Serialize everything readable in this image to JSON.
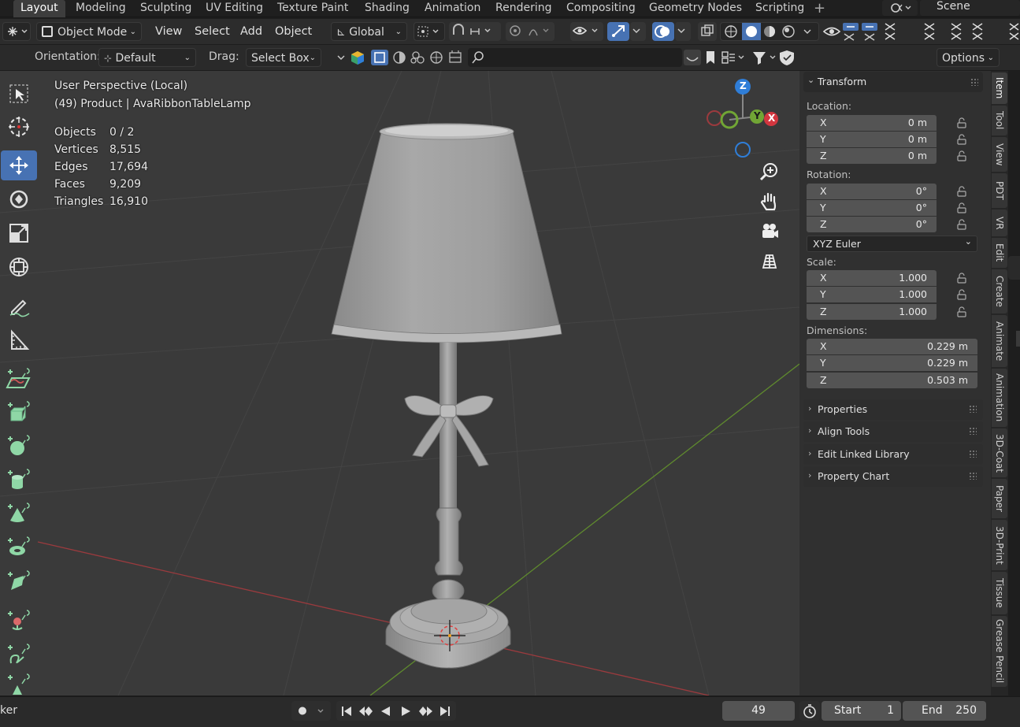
{
  "workspace_tabs": [
    "Layout",
    "Modeling",
    "Sculpting",
    "UV Editing",
    "Texture Paint",
    "Shading",
    "Animation",
    "Rendering",
    "Compositing",
    "Geometry Nodes",
    "Scripting"
  ],
  "scene_name": "Scene",
  "header": {
    "mode": "Object Mode",
    "menus": [
      "View",
      "Select",
      "Add",
      "Object"
    ],
    "transform_orientation": "Global"
  },
  "tool_header": {
    "orientation_label": "Orientation:",
    "orientation_value": "Default",
    "drag_label": "Drag:",
    "drag_value": "Select Box",
    "options_label": "Options"
  },
  "viewport": {
    "perspective": "User Perspective (Local)",
    "object_info": "(49) Product | AvaRibbonTableLamp",
    "stats": [
      {
        "label": "Objects",
        "value": "0 / 2"
      },
      {
        "label": "Vertices",
        "value": "8,515"
      },
      {
        "label": "Edges",
        "value": "17,694"
      },
      {
        "label": "Faces",
        "value": "9,209"
      },
      {
        "label": "Triangles",
        "value": "16,910"
      }
    ],
    "gizmo_axes": {
      "z": "Z",
      "y": "Y",
      "x": "X"
    }
  },
  "npanel": {
    "transform_title": "Transform",
    "location_label": "Location:",
    "location": [
      {
        "axis": "X",
        "value": "0 m"
      },
      {
        "axis": "Y",
        "value": "0 m"
      },
      {
        "axis": "Z",
        "value": "0 m"
      }
    ],
    "rotation_label": "Rotation:",
    "rotation": [
      {
        "axis": "X",
        "value": "0°"
      },
      {
        "axis": "Y",
        "value": "0°"
      },
      {
        "axis": "Z",
        "value": "0°"
      }
    ],
    "rotation_mode": "XYZ Euler",
    "scale_label": "Scale:",
    "scale": [
      {
        "axis": "X",
        "value": "1.000"
      },
      {
        "axis": "Y",
        "value": "1.000"
      },
      {
        "axis": "Z",
        "value": "1.000"
      }
    ],
    "dimensions_label": "Dimensions:",
    "dimensions": [
      {
        "axis": "X",
        "value": "0.229 m"
      },
      {
        "axis": "Y",
        "value": "0.229 m"
      },
      {
        "axis": "Z",
        "value": "0.503 m"
      }
    ],
    "subpanels": [
      "Properties",
      "Align Tools",
      "Edit Linked Library",
      "Property Chart"
    ]
  },
  "side_tabs": [
    "Item",
    "Tool",
    "View",
    "PDT",
    "VR",
    "Edit",
    "Create",
    "Animate",
    "Animation",
    "3D-Coat",
    "Paper",
    "3D-Print",
    "Tissue",
    "Grease Pencil"
  ],
  "timeline": {
    "left_label": "ker",
    "current_frame": "49",
    "start_label": "Start",
    "start_value": "1",
    "end_label": "End",
    "end_value": "250"
  },
  "colors": {
    "accent": "#4772b3",
    "x_axis": "#d2363f",
    "y_axis": "#71a535",
    "z_axis": "#2f7ed8",
    "viewport_bg": "#3a3a3a",
    "tool_icon_green": "#8fd7a6"
  }
}
